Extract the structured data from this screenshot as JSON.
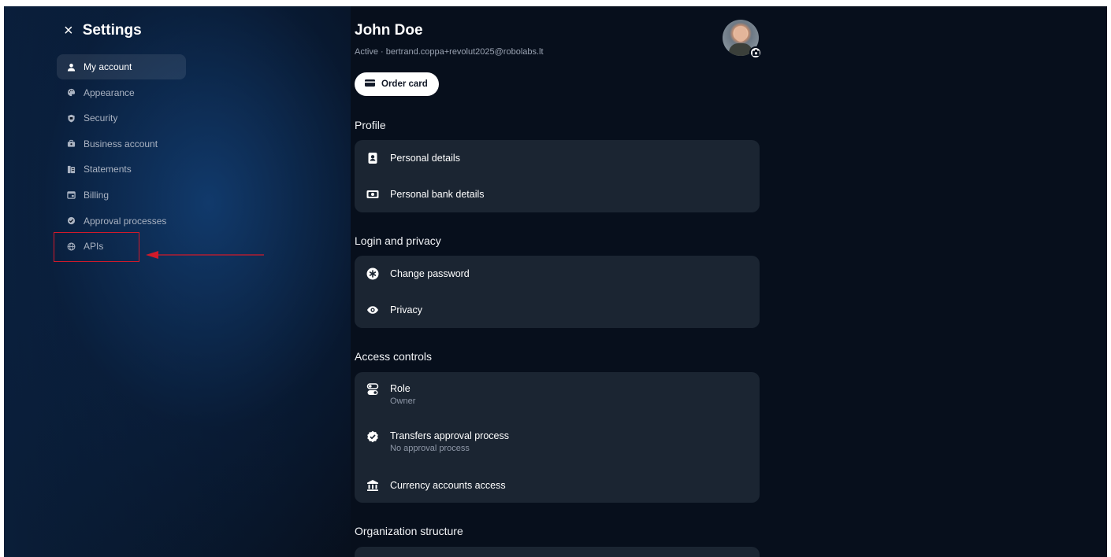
{
  "settings": {
    "close_icon": "×",
    "title": "Settings"
  },
  "sidebar": {
    "items": [
      {
        "label": "My account",
        "icon": "person-icon",
        "active": true
      },
      {
        "label": "Appearance",
        "icon": "palette-icon"
      },
      {
        "label": "Security",
        "icon": "shield-icon"
      },
      {
        "label": "Business account",
        "icon": "briefcase-icon"
      },
      {
        "label": "Statements",
        "icon": "statements-icon"
      },
      {
        "label": "Billing",
        "icon": "calendar-icon"
      },
      {
        "label": "Approval processes",
        "icon": "check-circle-icon"
      },
      {
        "label": "APIs",
        "icon": "globe-icon"
      }
    ]
  },
  "user": {
    "name": "John Doe",
    "status": "Active · bertrand.coppa+revolut2025@robolabs.lt"
  },
  "order_card": {
    "label": "Order card",
    "icon": "card-icon"
  },
  "sections": {
    "profile": {
      "title": "Profile",
      "rows": [
        {
          "label": "Personal details",
          "icon": "id-badge-icon"
        },
        {
          "label": "Personal bank details",
          "icon": "banknote-icon"
        }
      ]
    },
    "login": {
      "title": "Login and privacy",
      "rows": [
        {
          "label": "Change password",
          "icon": "asterisk-icon"
        },
        {
          "label": "Privacy",
          "icon": "eye-icon"
        }
      ]
    },
    "access": {
      "title": "Access controls",
      "rows": [
        {
          "label": "Role",
          "sub": "Owner",
          "icon": "toggles-icon"
        },
        {
          "label": "Transfers approval process",
          "sub": "No approval process",
          "icon": "check-badge-icon"
        },
        {
          "label": "Currency accounts access",
          "icon": "bank-icon"
        }
      ]
    },
    "org": {
      "title": "Organization structure"
    }
  },
  "colors": {
    "background": "#070f1c",
    "card": "#1b2532",
    "annotation": "#d11a2a"
  }
}
